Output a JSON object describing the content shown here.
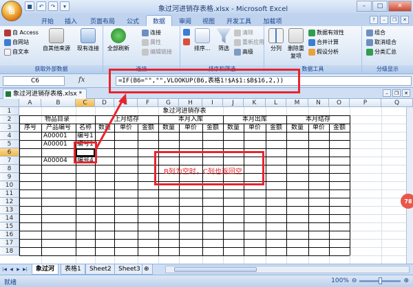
{
  "window": {
    "title": "象过河进销存表格.xlsx - Microsoft Excel",
    "office_button": "⊞"
  },
  "tabs": [
    "开始",
    "插入",
    "页面布局",
    "公式",
    "数据",
    "审阅",
    "视图",
    "开发工具",
    "加载项"
  ],
  "active_tab": "数据",
  "ribbon": {
    "external": {
      "label": "获取外部数据",
      "from_access": "自 Access",
      "from_web": "自网站",
      "from_text": "自文本",
      "other_sources": "自其他来源",
      "existing": "现有连接"
    },
    "connections": {
      "label": "连接",
      "refresh_all": "全部刷新",
      "conn": "连接",
      "props": "属性",
      "edit_links": "编辑链接"
    },
    "sort": {
      "label": "排序和筛选",
      "sort": "排序...",
      "filter": "筛选",
      "clear": "清除",
      "reapply": "重新应用",
      "advanced": "高级"
    },
    "tools": {
      "label": "数据工具",
      "split": "分列",
      "remove_dup": "删除重复项",
      "validation": "数据有效性",
      "consolidate": "合并计算",
      "whatif": "假设分析"
    },
    "outline": {
      "label": "分级显示",
      "group": "组合",
      "ungroup": "取消组合",
      "subtotal": "分类汇总"
    }
  },
  "formula_bar": {
    "cell_ref": "C6",
    "fx": "fx",
    "formula": "=IF(B6=\"\",\"\",VLOOKUP(B6,表格1!$A$1:$B$16,2,))"
  },
  "workbook_tab": "象过河进销存表格.xlsx *",
  "columns": [
    "A",
    "B",
    "C",
    "D",
    "E",
    "F",
    "G",
    "H",
    "I",
    "J",
    "K",
    "L",
    "M",
    "N",
    "O",
    "P",
    "Q"
  ],
  "rows": [
    "1",
    "2",
    "3",
    "4",
    "5",
    "6",
    "7",
    "8",
    "9",
    "10",
    "11",
    "12",
    "13",
    "14",
    "15",
    "16",
    "17",
    "18"
  ],
  "sheet": {
    "title": "象过河进销存表",
    "h_goods": "物品目录",
    "h_last": "上月结存",
    "h_in": "本月入库",
    "h_out": "本月出库",
    "h_bal": "本月结存",
    "sub_seq": "序号",
    "sub_code": "产品编号",
    "sub_name": "名称",
    "sub_qty": "数量",
    "sub_price": "单价",
    "sub_amount": "金额",
    "r4_code": "A00001",
    "r4_name": "编号1",
    "r5_code": "A00001",
    "r5_name": "编号1",
    "r7_code": "A00004",
    "r7_name": "编号4"
  },
  "annotation": "B列为空时，C列也返回空",
  "sheets": [
    "象过河",
    "表格1",
    "Sheet2",
    "Sheet3"
  ],
  "status": "就绪",
  "zoom": "100%",
  "badge": "78"
}
